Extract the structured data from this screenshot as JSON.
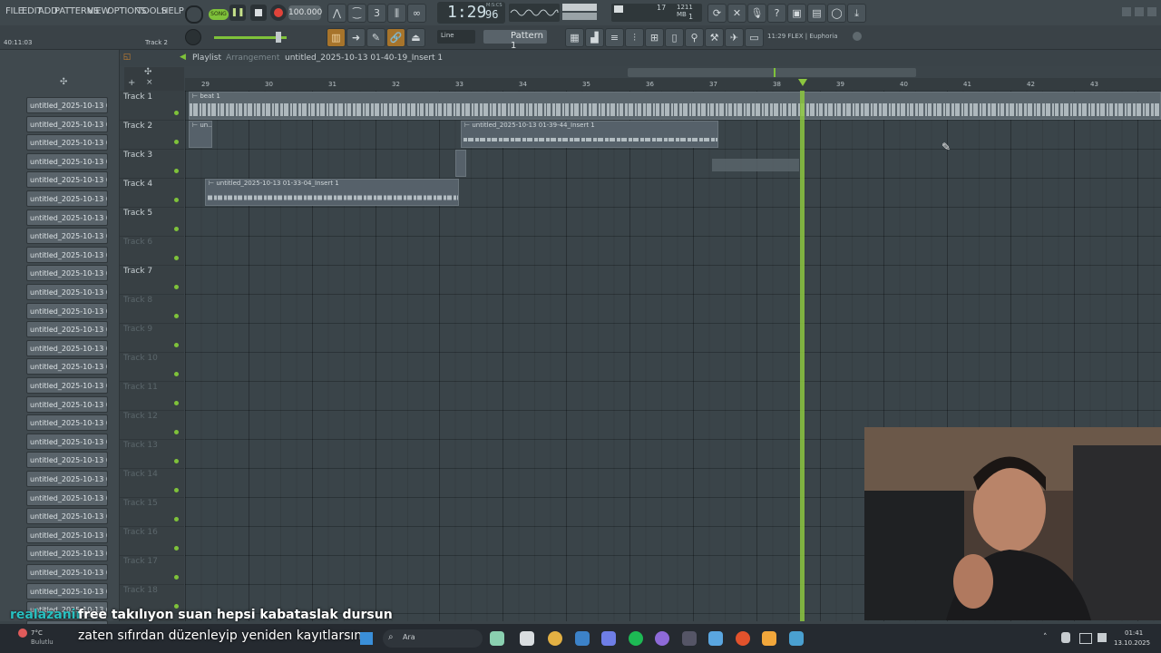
{
  "menu": [
    "FILE",
    "EDIT",
    "ADD",
    "PATTERNS",
    "VIEW",
    "OPTIONS",
    "TOOLS",
    "HELP"
  ],
  "transport": {
    "song_label": "SONG",
    "tempo": "100.000",
    "time": "1:29",
    "time_frac": "96",
    "time_unit": "M:S:CS",
    "cpu_num": "17",
    "memory": "1211 MB",
    "poly": "1"
  },
  "hint_bar": {
    "time": "40:11:03",
    "track": "Track 2"
  },
  "toolbar2": {
    "snap": "Line",
    "pattern": "Pattern 1",
    "plugin_hint": "11:29  FLEX | Euphoria"
  },
  "playlist": {
    "title": "Playlist",
    "subtitle": "Arrangement",
    "breadcrumb": "untitled_2025-10-13 01-40-19_Insert 1"
  },
  "browser_items": [
    "untitled_2025-10-13 01-...",
    "untitled_2025-10-13 01-...",
    "untitled_2025-10-13 01-...",
    "untitled_2025-10-13 01-...",
    "untitled_2025-10-13 01-...",
    "untitled_2025-10-13 01-...",
    "untitled_2025-10-13 01-...",
    "untitled_2025-10-13 01-...",
    "untitled_2025-10-13 01-...",
    "untitled_2025-10-13 01-...",
    "untitled_2025-10-13 01-...",
    "untitled_2025-10-13 01-...",
    "untitled_2025-10-13 01-...",
    "untitled_2025-10-13 01-...",
    "untitled_2025-10-13 01-...",
    "untitled_2025-10-13 01-...",
    "untitled_2025-10-13 01-...",
    "untitled_2025-10-13 01-...",
    "untitled_2025-10-13 01-...",
    "untitled_2025-10-13 01-...",
    "untitled_2025-10-13 01-...",
    "untitled_2025-10-13 01-...",
    "untitled_2025-10-13 01-...",
    "untitled_2025-10-13 01-...",
    "untitled_2025-10-13 01-...",
    "untitled_2025-10-13 01-...",
    "untitled_2025-10-13 01-...",
    "untitled_2025-10-13 01-...",
    "untitled_2025-10-13 01-..."
  ],
  "tracks": [
    {
      "name": "Track 1",
      "active": true
    },
    {
      "name": "Track 2",
      "active": true
    },
    {
      "name": "Track 3",
      "active": true
    },
    {
      "name": "Track 4",
      "active": true
    },
    {
      "name": "Track 5",
      "active": true
    },
    {
      "name": "Track 6",
      "active": false
    },
    {
      "name": "Track 7",
      "active": true
    },
    {
      "name": "Track 8",
      "active": false
    },
    {
      "name": "Track 9",
      "active": false
    },
    {
      "name": "Track 10",
      "active": false
    },
    {
      "name": "Track 11",
      "active": false
    },
    {
      "name": "Track 12",
      "active": false
    },
    {
      "name": "Track 13",
      "active": false
    },
    {
      "name": "Track 14",
      "active": false
    },
    {
      "name": "Track 15",
      "active": false
    },
    {
      "name": "Track 16",
      "active": false
    },
    {
      "name": "Track 17",
      "active": false
    },
    {
      "name": "Track 18",
      "active": false
    }
  ],
  "ruler_bars": [
    "29",
    "30",
    "31",
    "32",
    "33",
    "34",
    "35",
    "36",
    "37",
    "38",
    "39",
    "40",
    "41",
    "42",
    "43"
  ],
  "clips": {
    "beat": "beat 1",
    "un": "un..1",
    "insert_3944": "untitled_2025-10-13 01-39-44_Insert 1",
    "insert_3304": "untitled_2025-10-13 01-33-04_Insert 1"
  },
  "chat": {
    "user": "realazanir",
    "line1": "free takılıyon suan hepsi kabataslak dursun",
    "line2": "zaten sıfırdan düzenleyip yeniden kayıtlarsın"
  },
  "taskbar": {
    "weather_temp": "7°C",
    "weather_desc": "Bulutlu",
    "search_placeholder": "Ara",
    "clock_time": "01:41",
    "clock_date": "13.10.2025"
  },
  "colors": {
    "accent_green": "#7fc23a",
    "record_red": "#e0433a",
    "orange": "#d2852d"
  }
}
